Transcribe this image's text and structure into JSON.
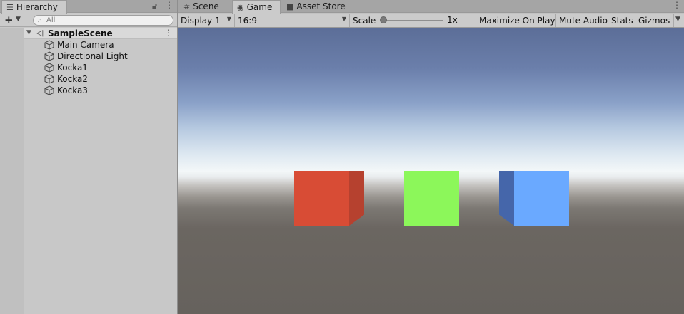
{
  "hierarchy": {
    "tab_label": "Hierarchy",
    "search_placeholder": "All",
    "scene_name": "SampleScene",
    "items": [
      {
        "label": "Main Camera"
      },
      {
        "label": "Directional Light"
      },
      {
        "label": "Kocka1"
      },
      {
        "label": "Kocka2"
      },
      {
        "label": "Kocka3"
      }
    ]
  },
  "game_panel": {
    "tabs": [
      {
        "label": "Scene"
      },
      {
        "label": "Game"
      },
      {
        "label": "Asset Store"
      }
    ],
    "active_tab": "Game",
    "toolbar": {
      "display": "Display 1",
      "aspect": "16:9",
      "scale_label": "Scale",
      "scale_value": "1x",
      "scale_fraction": 0.0,
      "maximize_label": "Maximize On Play",
      "mute_label": "Mute Audio",
      "stats_label": "Stats",
      "gizmos_label": "Gizmos"
    },
    "cubes": [
      {
        "name": "red-cube",
        "front_color": "#d84c35",
        "side_color": "#b6412f"
      },
      {
        "name": "green-cube",
        "front_color": "#8cf75a"
      },
      {
        "name": "blue-cube",
        "front_color": "#6aa9ff",
        "side_color": "#4566aa"
      }
    ]
  },
  "colors": {
    "panel_bg": "#c8c8c8",
    "tab_bar_bg": "#a5a5a5",
    "sky_top": "#5c6e98",
    "horizon": "#f3f7f8",
    "ground": "#66625d"
  }
}
